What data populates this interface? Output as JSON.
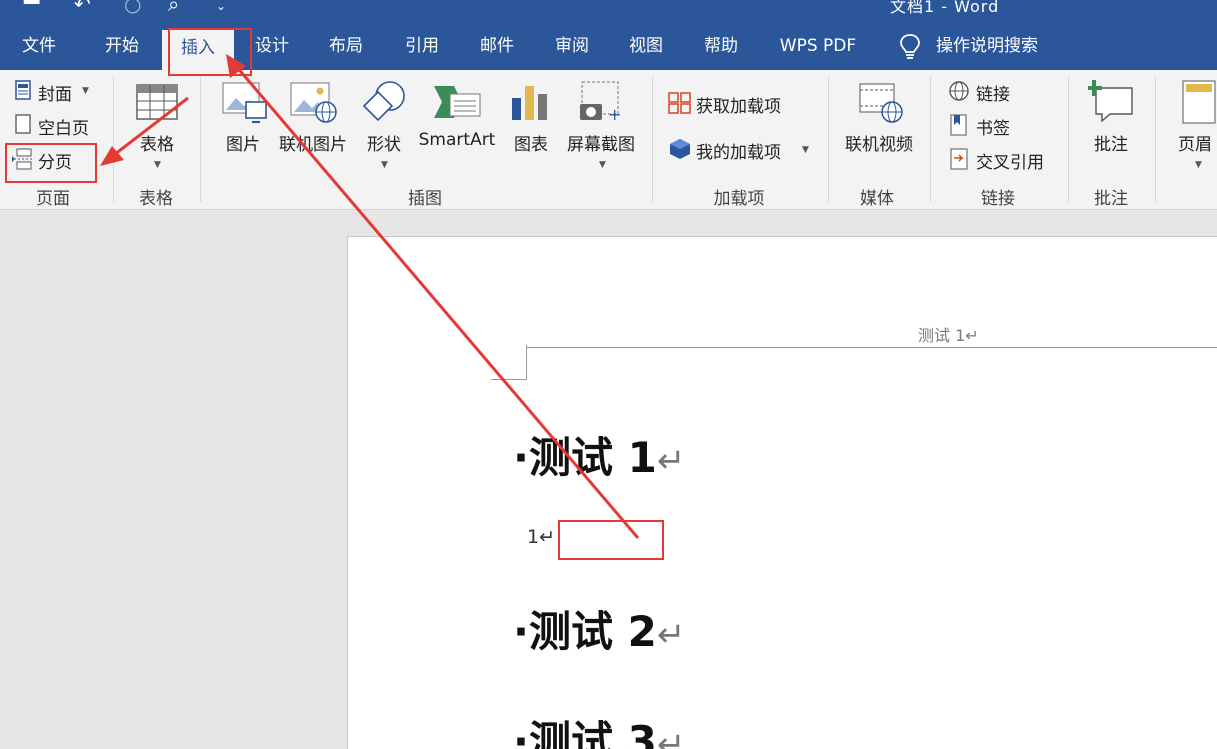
{
  "app": {
    "title_partial": "文档1 - Word",
    "tabs": [
      "文件",
      "开始",
      "插入",
      "设计",
      "布局",
      "引用",
      "邮件",
      "审阅",
      "视图",
      "帮助",
      "WPS PDF"
    ],
    "active_tab": "插入",
    "search_label": "操作说明搜索"
  },
  "ribbon": {
    "pages_group": {
      "label": "页面",
      "cover": "封面",
      "blank_page": "空白页",
      "page_break": "分页"
    },
    "table_group": {
      "label": "表格",
      "table": "表格"
    },
    "illustrations_group": {
      "label": "插图",
      "picture": "图片",
      "online_picture": "联机图片",
      "shapes": "形状",
      "smartart": "SmartArt",
      "chart": "图表",
      "screenshot": "屏幕截图"
    },
    "addins_group": {
      "label": "加载项",
      "get_addins": "获取加载项",
      "my_addins": "我的加载项"
    },
    "media_group": {
      "label": "媒体",
      "online_video": "联机视频"
    },
    "links_group": {
      "label": "链接",
      "link": "链接",
      "bookmark": "书签",
      "cross_reference": "交叉引用"
    },
    "comments_group": {
      "label": "批注",
      "comment": "批注"
    },
    "header_group": {
      "header": "页眉"
    }
  },
  "document": {
    "header_text": "测试 1↵",
    "headings": [
      "测试 1",
      "测试 2",
      "测试 3"
    ],
    "return_mark": "↵",
    "body_line": "1↵"
  },
  "colors": {
    "accent": "#2b579a",
    "annotation": "#e53935"
  }
}
